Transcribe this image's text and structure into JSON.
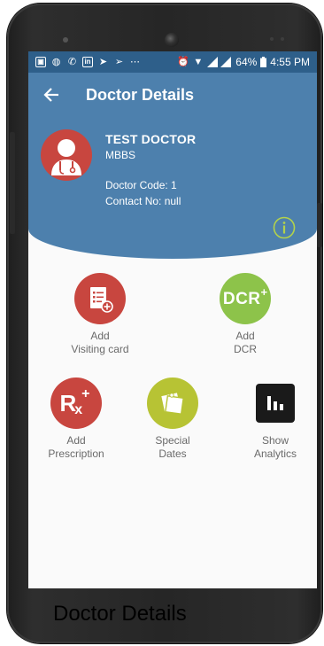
{
  "status_bar": {
    "battery": "64%",
    "time": "4:55 PM"
  },
  "app_bar": {
    "title": "Doctor Details"
  },
  "doctor": {
    "name": "TEST DOCTOR",
    "degree": "MBBS",
    "code": "Doctor Code: 1",
    "contact": "Contact No: null"
  },
  "actions": [
    {
      "line1": "Add",
      "line2": "Visiting card",
      "color": "#c8463f"
    },
    {
      "line1": "Add",
      "line2": "DCR",
      "color": "#8dc34a",
      "badge": "DCR",
      "sup": "+"
    },
    {
      "line1": "Add",
      "line2": "Prescription",
      "color": "#c8463f",
      "badge": "R",
      "sub": "x",
      "sup": "+"
    },
    {
      "line1": "Special",
      "line2": "Dates",
      "color": "#b7c334"
    },
    {
      "line1": "Show",
      "line2": "Analytics",
      "color": "#1a1a1a"
    }
  ],
  "caption": "Doctor Details",
  "colors": {
    "app_bar": "#4d80ad",
    "status_bar": "#2e5f8a",
    "info_icon": "#b3d24b"
  }
}
